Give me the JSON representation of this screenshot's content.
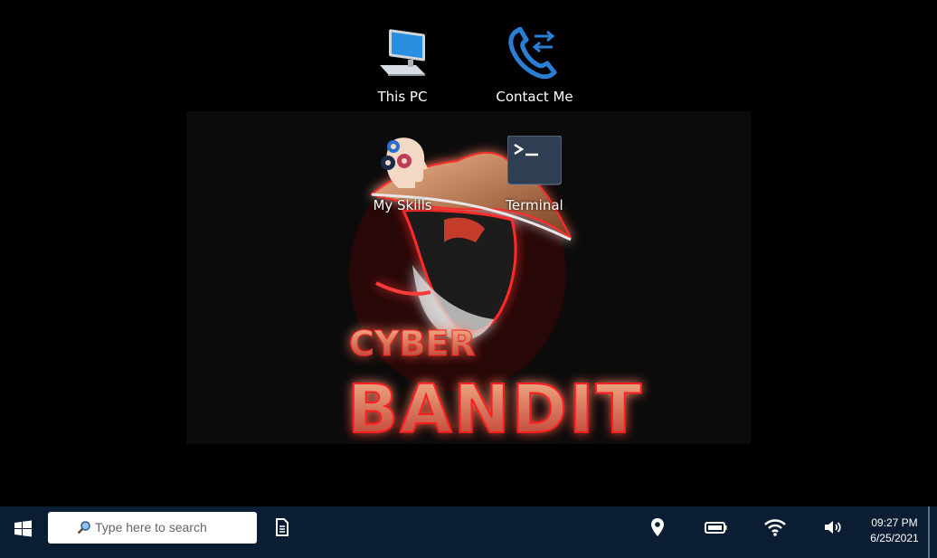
{
  "desktop": {
    "wallpaper": {
      "logo_line1": "CYBER",
      "logo_line2": "BANDIT"
    },
    "icons": [
      {
        "label": "This PC",
        "icon": "computer-icon"
      },
      {
        "label": "Contact Me",
        "icon": "phone-icon"
      },
      {
        "label": "My Skills",
        "icon": "skills-head-icon"
      },
      {
        "label": "Terminal",
        "icon": "terminal-icon"
      }
    ]
  },
  "taskbar": {
    "start_icon": "windows-logo-icon",
    "search": {
      "placeholder": "Type here to search",
      "icon": "search-icon"
    },
    "pinned": [
      {
        "icon": "document-icon"
      }
    ],
    "tray": [
      {
        "icon": "location-icon"
      },
      {
        "icon": "battery-icon"
      },
      {
        "icon": "wifi-icon"
      },
      {
        "icon": "volume-icon"
      }
    ],
    "clock": {
      "time": "09:27 PM",
      "date": "6/25/2021"
    }
  },
  "colors": {
    "taskbar_bg": "#0b1d33",
    "desktop_bg": "#000000",
    "logo_red": "#e02020",
    "terminal_tile": "#2f3e52"
  }
}
